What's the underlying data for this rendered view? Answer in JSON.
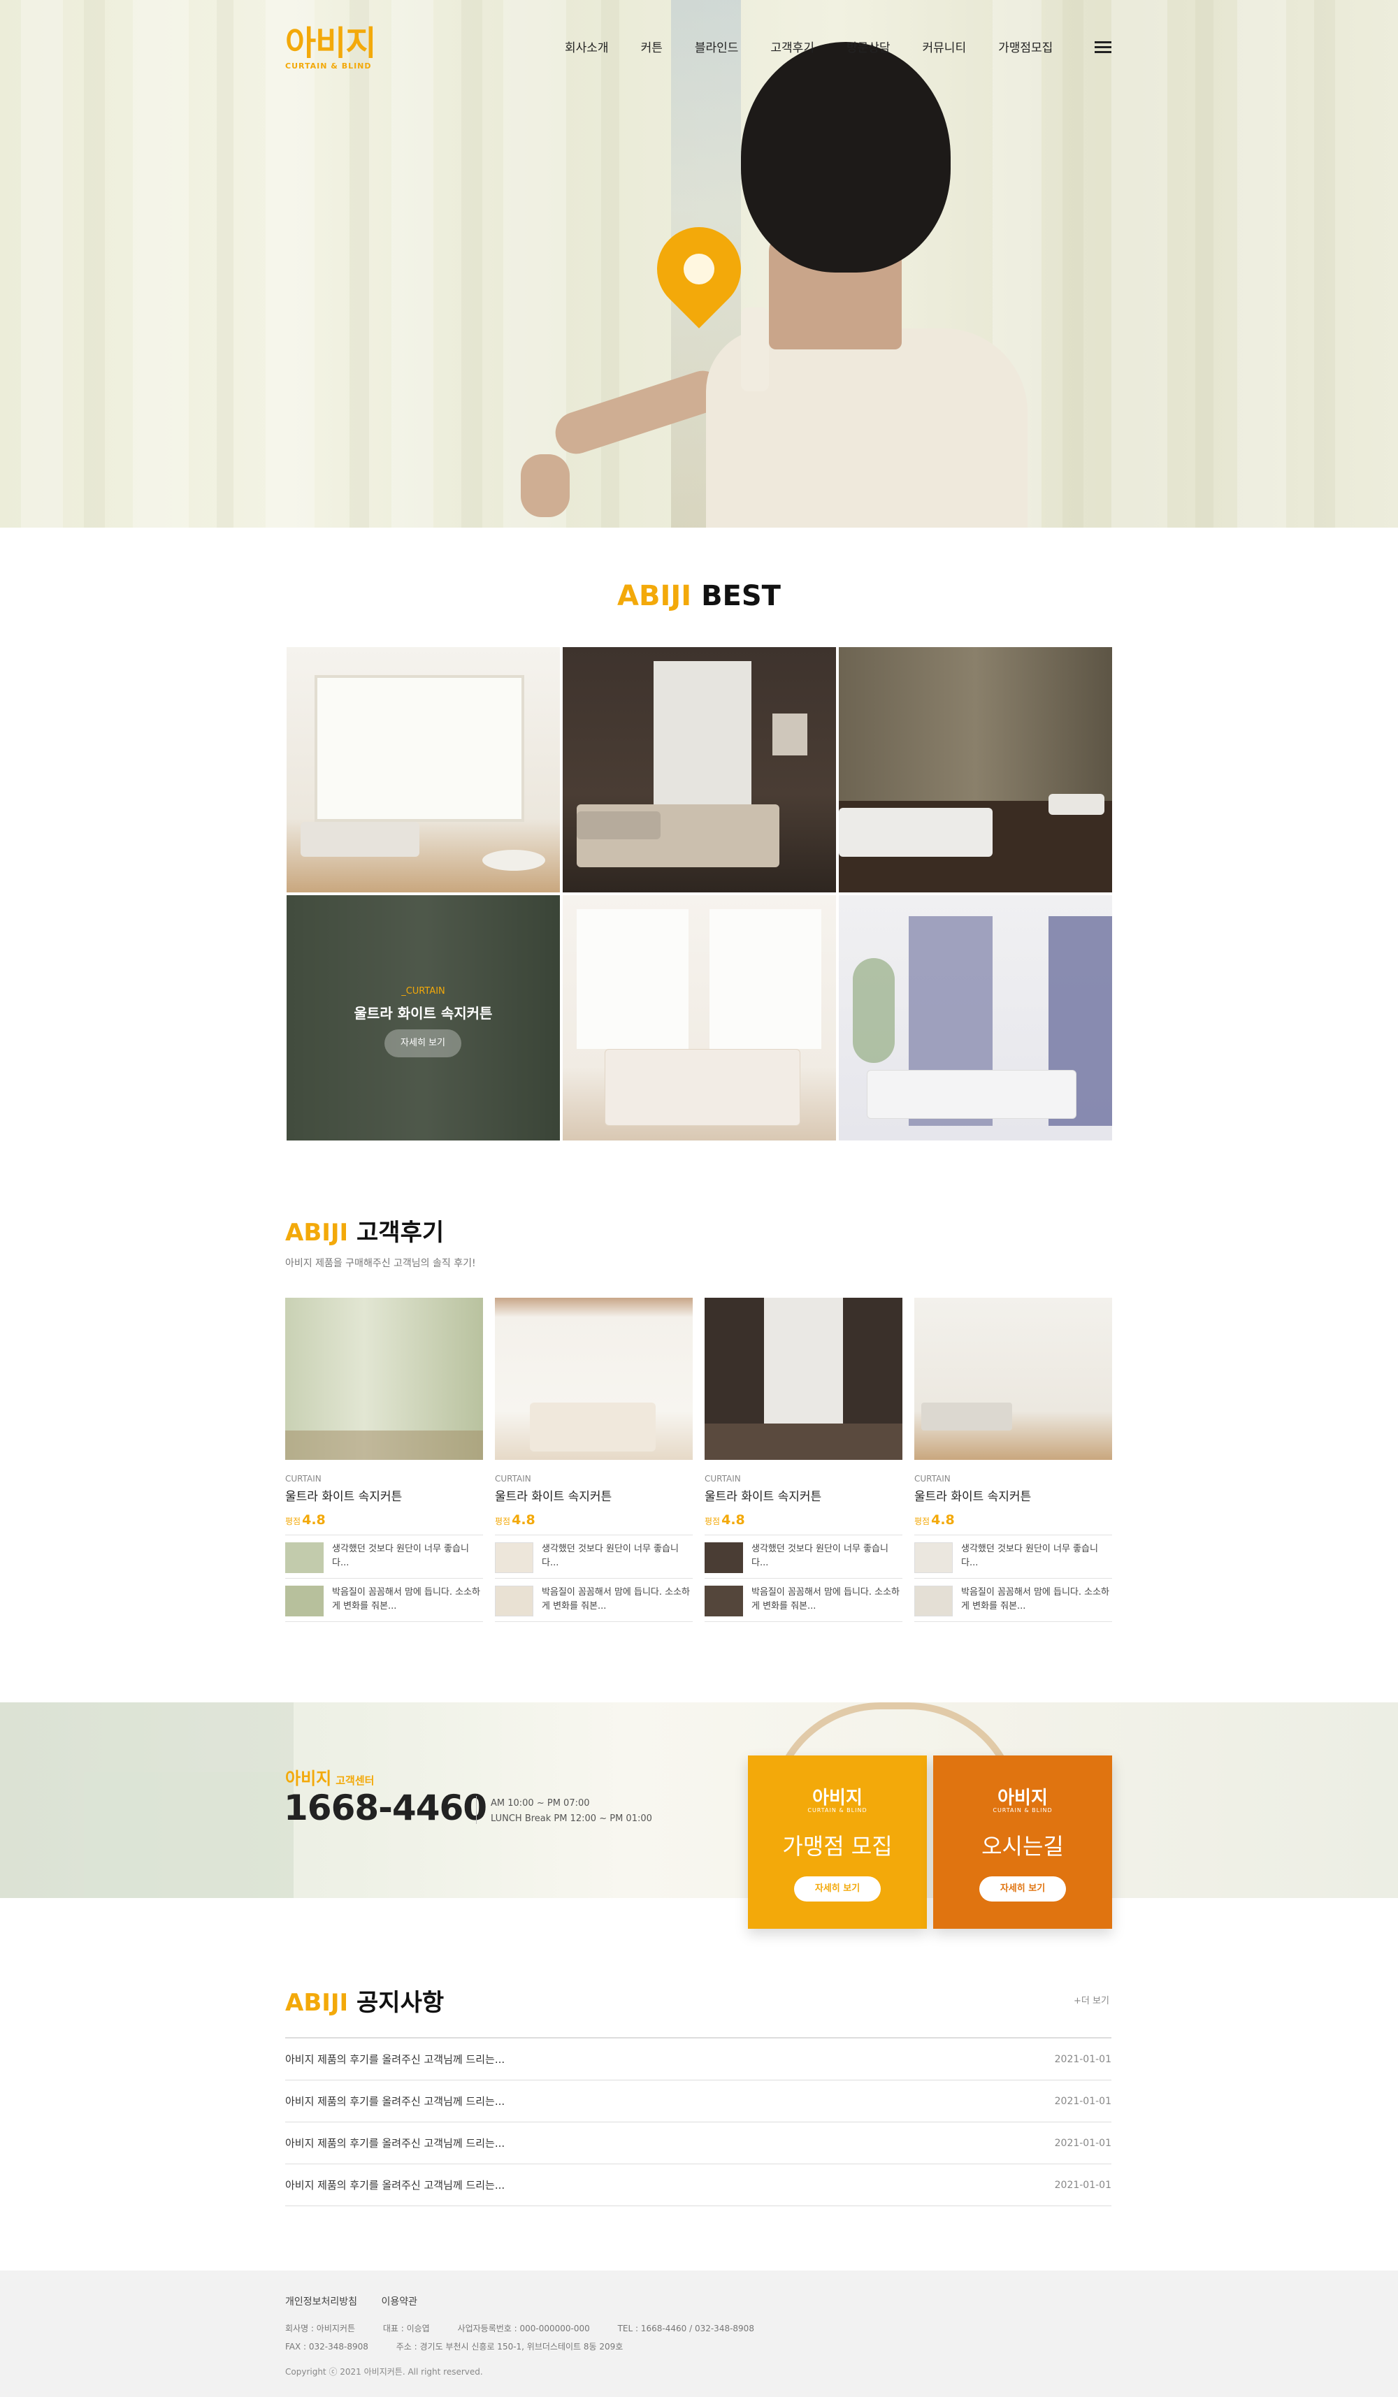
{
  "brand": {
    "name": "아비지",
    "tagline": "CURTAIN & BLIND",
    "accent_color": "#f3a90a",
    "dark_orange": "#e07410"
  },
  "nav": {
    "items": [
      "회사소개",
      "커튼",
      "블라인드",
      "고객후기",
      "방문상담",
      "커뮤니티",
      "가맹점모집"
    ],
    "menu_icon": "hamburger-menu-icon"
  },
  "hero": {
    "marker_icon": "location-pin-icon"
  },
  "best": {
    "title_accent": "ABIJI",
    "title_rest": "BEST",
    "featured": {
      "category": "_CURTAIN",
      "name": "울트라 화이트 속지커튼",
      "button": "자세히 보기"
    }
  },
  "reviews": {
    "title_accent": "ABIJI",
    "title_rest": "고객후기",
    "subtitle": "아비지 제품을 구매해주신 고객님의 솔직 후기!",
    "cards": [
      {
        "category": "CURTAIN",
        "name": "울트라 화이트 속지커튼",
        "rating_label": "평점",
        "rating": "4.8",
        "comments": [
          "생각했던 것보다 원단이 너무 좋습니다...",
          "박음질이 꼼꼼해서 맘에 듭니다. 소소하게 변화를 줘본..."
        ]
      },
      {
        "category": "CURTAIN",
        "name": "울트라 화이트 속지커튼",
        "rating_label": "평점",
        "rating": "4.8",
        "comments": [
          "생각했던 것보다 원단이 너무 좋습니다...",
          "박음질이 꼼꼼해서 맘에 듭니다. 소소하게 변화를 줘본..."
        ]
      },
      {
        "category": "CURTAIN",
        "name": "울트라 화이트 속지커튼",
        "rating_label": "평점",
        "rating": "4.8",
        "comments": [
          "생각했던 것보다 원단이 너무 좋습니다...",
          "박음질이 꼼꼼해서 맘에 듭니다. 소소하게 변화를 줘본..."
        ]
      },
      {
        "category": "CURTAIN",
        "name": "울트라 화이트 속지커튼",
        "rating_label": "평점",
        "rating": "4.8",
        "comments": [
          "생각했던 것보다 원단이 너무 좋습니다...",
          "박음질이 꼼꼼해서 맘에 듭니다. 소소하게 변화를 줘본..."
        ]
      }
    ]
  },
  "customer_center": {
    "brand": "아비지",
    "label": "고객센터",
    "phone": "1668-4460",
    "hours": "AM 10:00 ~ PM 07:00",
    "lunch": "LUNCH Break PM 12:00 ~ PM 01:00"
  },
  "promos": [
    {
      "logo": "아비지",
      "logo_sub": "CURTAIN & BLIND",
      "title": "가맹점 모집",
      "button": "자세히 보기",
      "color": "#f3a90a"
    },
    {
      "logo": "아비지",
      "logo_sub": "CURTAIN & BLIND",
      "title": "오시는길",
      "button": "자세히 보기",
      "color": "#e07410"
    }
  ],
  "notice": {
    "title_accent": "ABIJI",
    "title_rest": "공지사항",
    "more": "+더 보기",
    "rows": [
      {
        "title": "아비지 제품의 후기를 올려주신 고객님께 드리는...",
        "date": "2021-01-01"
      },
      {
        "title": "아비지 제품의 후기를 올려주신 고객님께 드리는...",
        "date": "2021-01-01"
      },
      {
        "title": "아비지 제품의 후기를 올려주신 고객님께 드리는...",
        "date": "2021-01-01"
      },
      {
        "title": "아비지 제품의 후기를 올려주신 고객님께 드리는...",
        "date": "2021-01-01"
      }
    ]
  },
  "footer": {
    "links": [
      "개인정보처리방침",
      "이용약관"
    ],
    "company": "회사명 : 아비지커튼",
    "ceo": "대표 : 이승엽",
    "biz_no": "사업자등록번호 : 000-000000-000",
    "tel": "TEL : 1668-4460 / 032-348-8908",
    "fax": "FAX : 032-348-8908",
    "address": "주소 : 경기도 부천시 신흥로 150-1, 위브더스테이트 8동 209호",
    "copyright": "Copyright ⓒ 2021 아비지커튼. All right reserved."
  }
}
